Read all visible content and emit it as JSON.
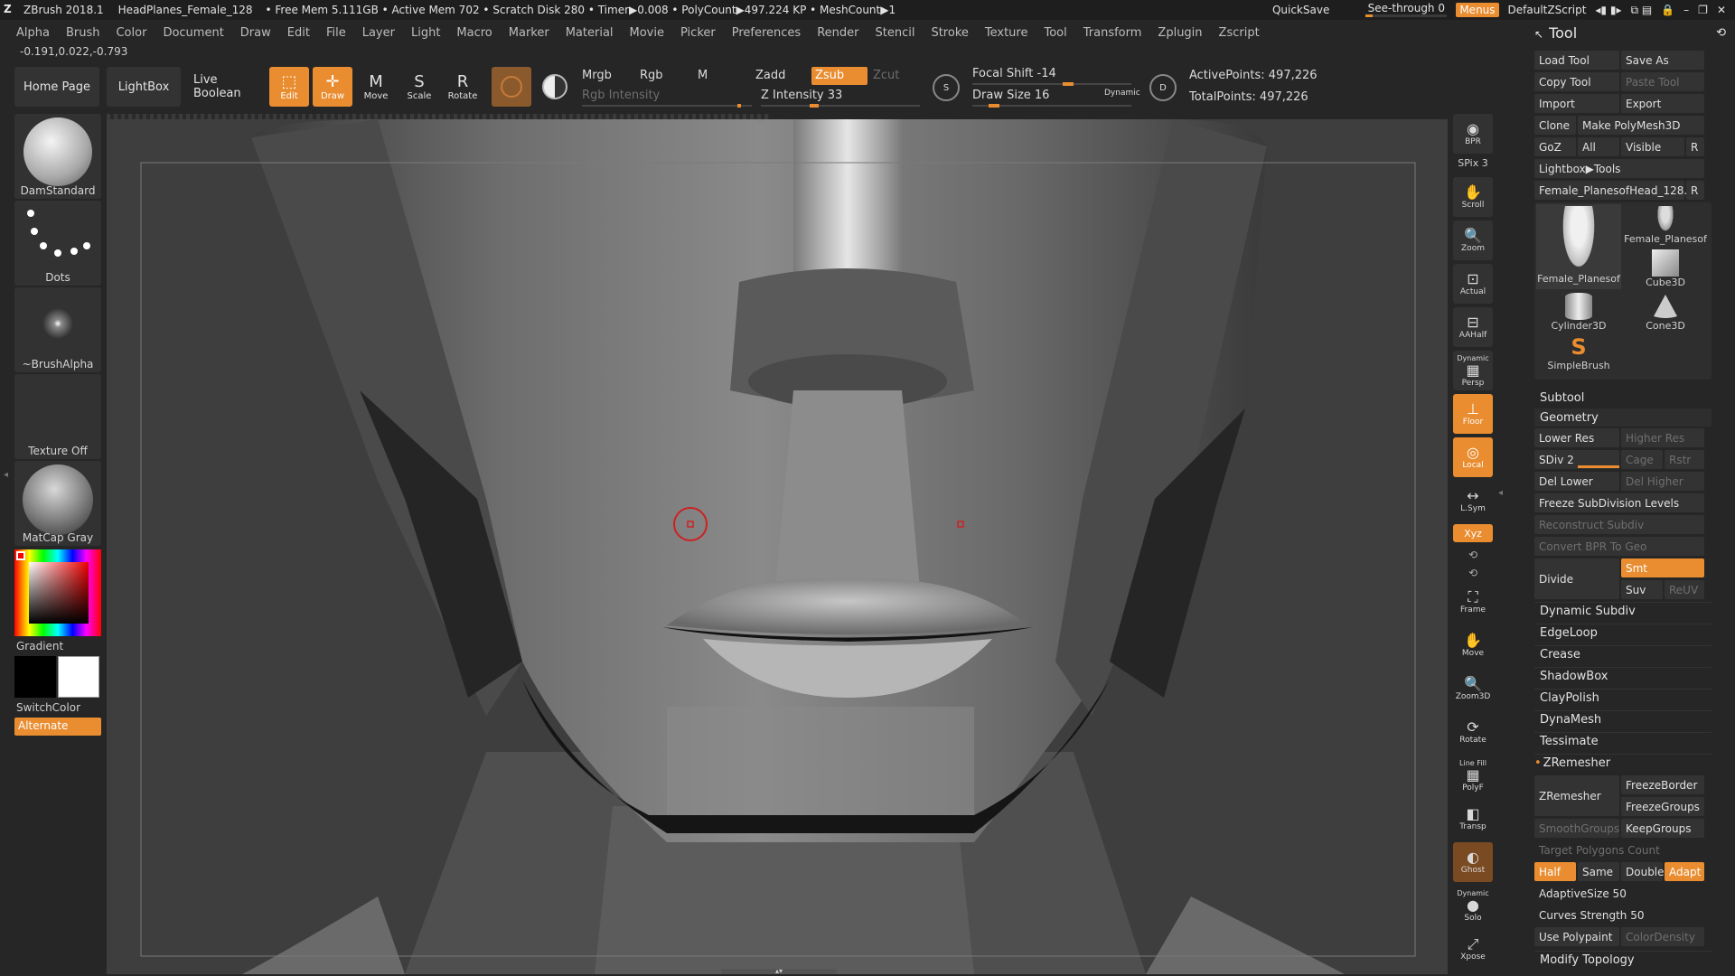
{
  "titlebar": {
    "app": "ZBrush 2018.1",
    "doc": "HeadPlanes_Female_128",
    "stats": "• Free Mem 5.111GB • Active Mem 702 • Scratch Disk 280 • Timer▶0.008 • PolyCount▶497.224 KP • MeshCount▶1",
    "quicksave": "QuickSave",
    "seethrough": "See-through  0",
    "menus": "Menus",
    "script": "DefaultZScript"
  },
  "menu": [
    "Alpha",
    "Brush",
    "Color",
    "Document",
    "Draw",
    "Edit",
    "File",
    "Layer",
    "Light",
    "Macro",
    "Marker",
    "Material",
    "Movie",
    "Picker",
    "Preferences",
    "Render",
    "Stencil",
    "Stroke",
    "Texture",
    "Tool",
    "Transform",
    "Zplugin",
    "Zscript"
  ],
  "coords": "-0.191,0.022,-0.793",
  "toolbar": {
    "home": "Home Page",
    "lightbox": "LightBox",
    "liveboolean": "Live Boolean",
    "edit": "Edit",
    "draw": "Draw",
    "move": "Move",
    "scale": "Scale",
    "rotate": "Rotate"
  },
  "controls": {
    "mrgb": "Mrgb",
    "rgb": "Rgb",
    "m": "M",
    "zadd": "Zadd",
    "zsub": "Zsub",
    "zcut": "Zcut",
    "rgb_intensity": "Rgb Intensity",
    "z_intensity": "Z Intensity 33",
    "z_intensity_value": 33,
    "focal_shift": "Focal Shift -14",
    "draw_size": "Draw Size 16",
    "dynamic": "Dynamic",
    "active_points": "ActivePoints: 497,226",
    "total_points": "TotalPoints: 497,226"
  },
  "left": {
    "brush": "DamStandard",
    "stroke": "Dots",
    "alpha": "~BrushAlpha",
    "texture": "Texture Off",
    "material": "MatCap Gray",
    "gradient": "Gradient",
    "switchcolor": "SwitchColor",
    "alternate": "Alternate"
  },
  "rightstrip": {
    "bpr": "BPR",
    "spix": "SPix 3",
    "scroll": "Scroll",
    "zoom": "Zoom",
    "actual": "Actual",
    "aahalf": "AAHalf",
    "dynamic_persp": "Dynamic",
    "persp": "Persp",
    "floor": "Floor",
    "local": "Local",
    "lsym": "L.Sym",
    "xyz": "Xyz",
    "frame": "Frame",
    "move": "Move",
    "zoom3d": "Zoom3D",
    "rotate": "Rotate",
    "linefill": "Line Fill",
    "polyf": "PolyF",
    "transp": "Transp",
    "ghost": "Ghost",
    "dynamic_solo": "Dynamic",
    "solo": "Solo",
    "xpose": "Xpose"
  },
  "tool": {
    "header": "Tool",
    "load": "Load Tool",
    "saveas": "Save As",
    "copy": "Copy Tool",
    "paste": "Paste Tool",
    "import": "Import",
    "export": "Export",
    "clone": "Clone",
    "makepoly": "Make PolyMesh3D",
    "goz": "GoZ",
    "all": "All",
    "visible": "Visible",
    "r": "R",
    "lightboxtools": "Lightbox▶Tools",
    "current": "Female_PlanesofHead_128.",
    "thumbs": [
      "Female_Planesof",
      "Female_Planesof",
      "Cube3D",
      "Cylinder3D",
      "Cone3D",
      "SimpleBrush"
    ],
    "subtool": "Subtool",
    "geometry": "Geometry",
    "lowerres": "Lower Res",
    "higherres": "Higher Res",
    "sdiv": "SDiv 2",
    "cage": "Cage",
    "rstr": "Rstr",
    "dellower": "Del Lower",
    "delhigher": "Del Higher",
    "freeze": "Freeze SubDivision Levels",
    "reconstruct": "Reconstruct Subdiv",
    "convertbpr": "Convert BPR To Geo",
    "divide": "Divide",
    "smt": "Smt",
    "suv": "Suv",
    "reuv": "ReUV",
    "dynsubdiv": "Dynamic Subdiv",
    "edgeloop": "EdgeLoop",
    "crease": "Crease",
    "shadowbox": "ShadowBox",
    "claypolish": "ClayPolish",
    "dynamesh": "DynaMesh",
    "tessimate": "Tessimate",
    "zremesher_sec": "ZRemesher",
    "zremesher": "ZRemesher",
    "freezeborder": "FreezeBorder",
    "freezegroups": "FreezeGroups",
    "smoothgroups": "SmoothGroups",
    "keepgroups": "KeepGroups",
    "targetpoly": "Target Polygons Count",
    "half": "Half",
    "same": "Same",
    "double": "Double",
    "adapt": "Adapt",
    "adaptivesize": "AdaptiveSize 50",
    "curves": "Curves Strength 50",
    "usepolypaint": "Use Polypaint",
    "colordensity": "ColorDensity",
    "modifytopo": "Modify Topology"
  },
  "colors": {
    "accent": "#e98d30",
    "panel": "#333333",
    "background": "#262626"
  }
}
